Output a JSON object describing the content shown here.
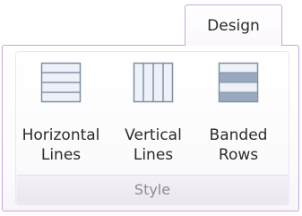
{
  "ribbon": {
    "tab_label": "Design",
    "group": {
      "label": "Style",
      "buttons": [
        {
          "line1": "Horizontal",
          "line2": "Lines",
          "icon": "horizontal-lines-icon"
        },
        {
          "line1": "Vertical",
          "line2": "Lines",
          "icon": "vertical-lines-icon"
        },
        {
          "line1": "Banded",
          "line2": "Rows",
          "icon": "banded-rows-icon"
        }
      ]
    }
  },
  "colors": {
    "tab_border": "#c7a8d9",
    "icon_stroke": "#7f8fa6",
    "icon_fill": "#eef2f8",
    "band_fill": "#9aa8bd"
  }
}
